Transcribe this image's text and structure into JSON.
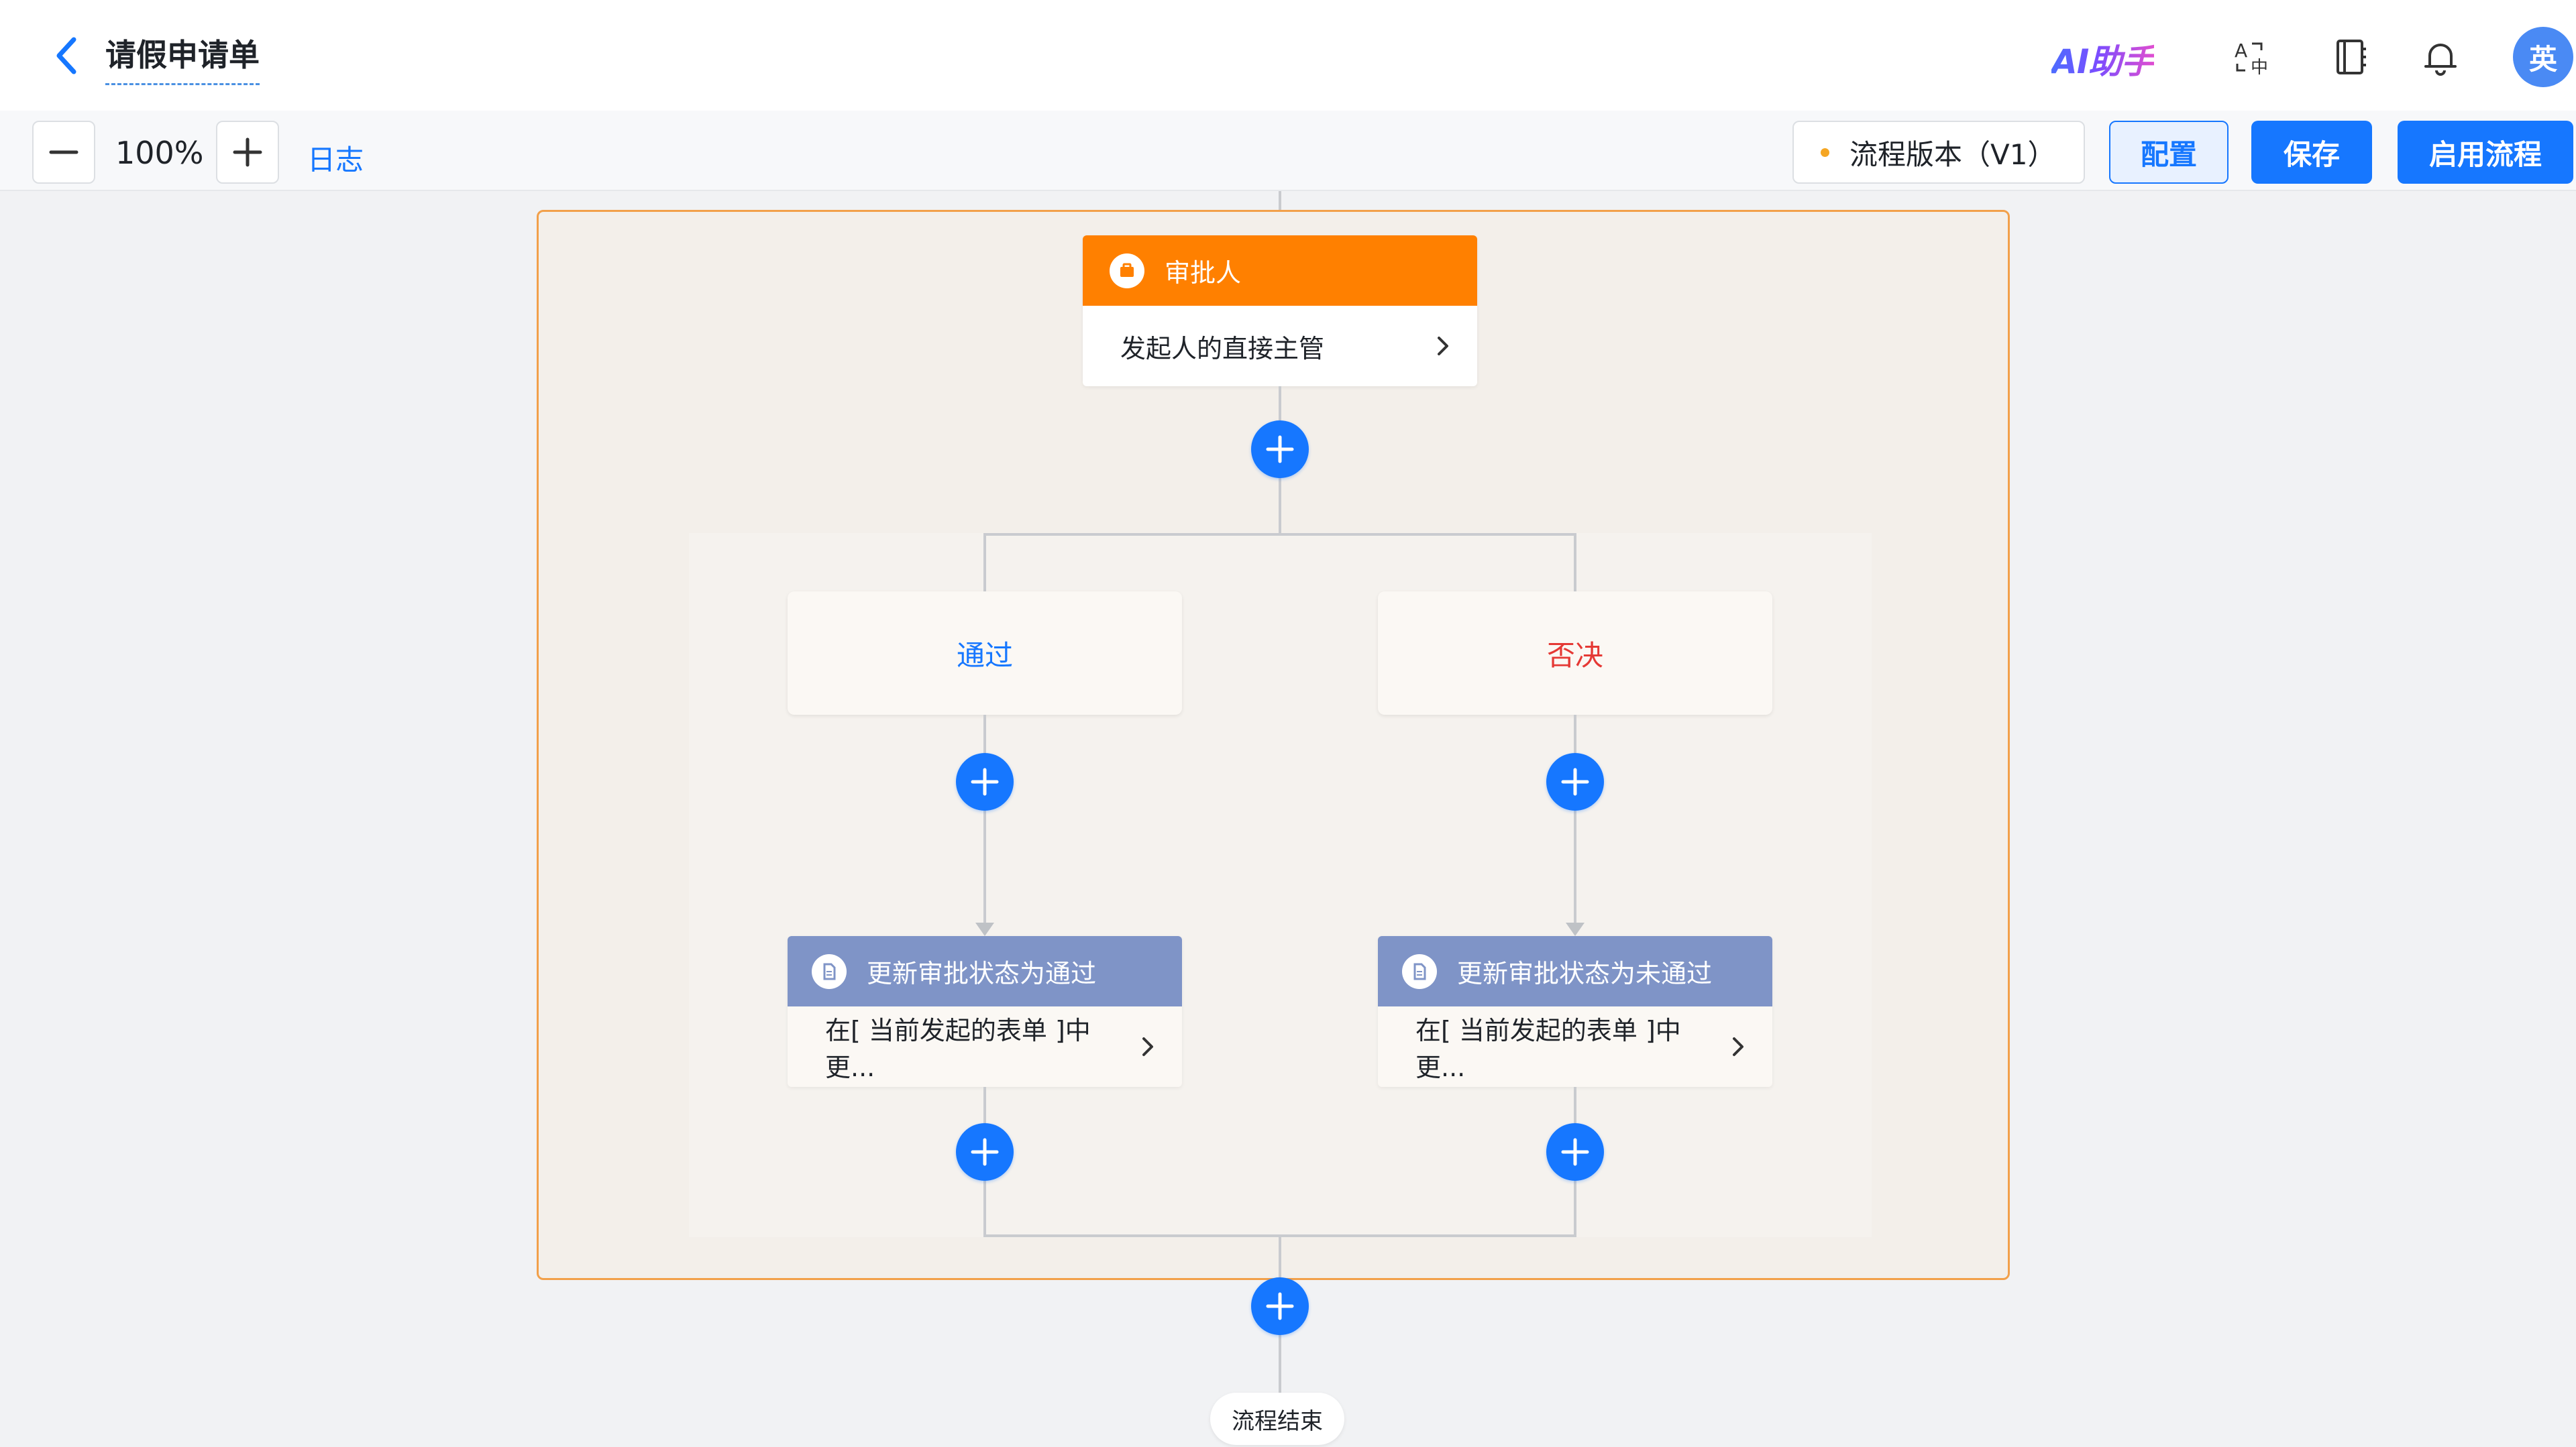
{
  "header": {
    "title": "请假申请单",
    "ai_label": "AI助手",
    "avatar_text": "英"
  },
  "toolbar": {
    "zoom": "100%",
    "log_label": "日志",
    "version_label": "流程版本（V1）",
    "config_label": "配置",
    "save_label": "保存",
    "start_label": "启用流程"
  },
  "flow": {
    "approver": {
      "title": "审批人",
      "detail": "发起人的直接主管"
    },
    "conditions": [
      {
        "label": "通过",
        "color": "#1677ff"
      },
      {
        "label": "否决",
        "color": "#e53935"
      }
    ],
    "updates": [
      {
        "title": "更新审批状态为通过",
        "detail": "在[ 当前发起的表单 ]中更..."
      },
      {
        "title": "更新审批状态为未通过",
        "detail": "在[ 当前发起的表单 ]中更..."
      }
    ],
    "end_label": "流程结束"
  },
  "colors": {
    "primary": "#1677ff",
    "approver_header": "#ff8000",
    "update_header": "#7f94c7",
    "branch_border": "#f2a04a"
  }
}
